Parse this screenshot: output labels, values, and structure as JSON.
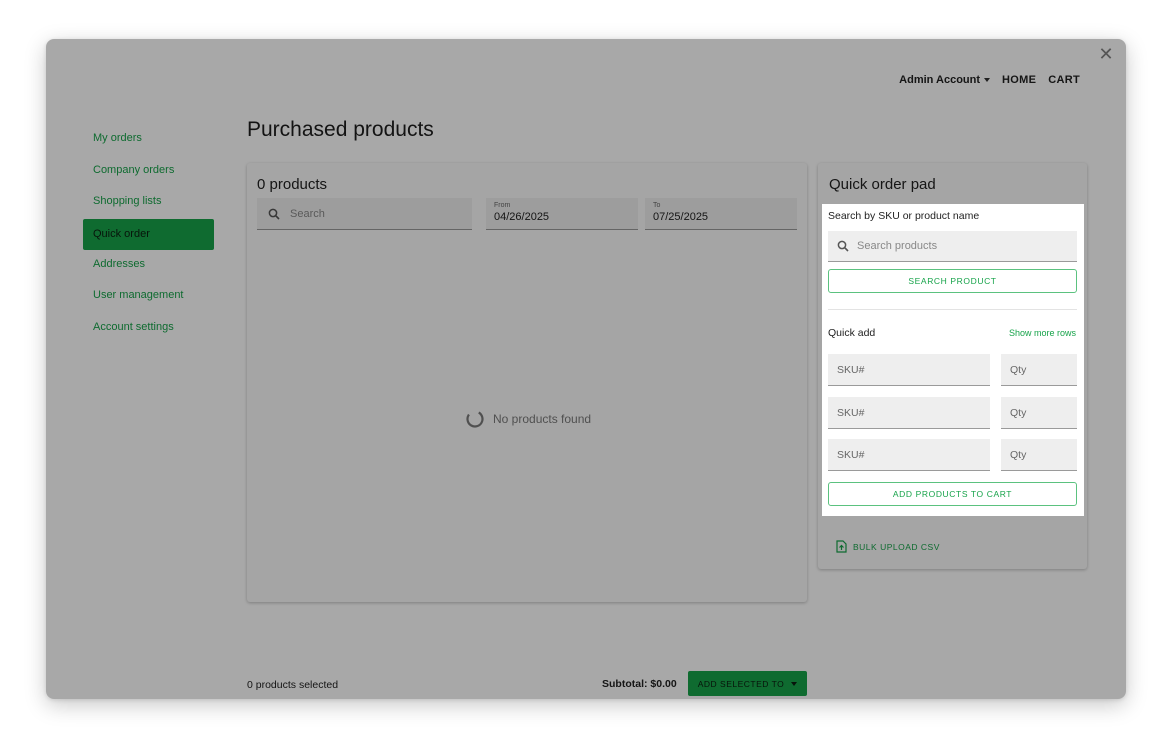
{
  "header": {
    "account_label": "Admin Account",
    "home_label": "HOME",
    "cart_label": "CART"
  },
  "sidebar": {
    "items": [
      {
        "label": "My orders"
      },
      {
        "label": "Company orders"
      },
      {
        "label": "Shopping lists"
      },
      {
        "label": "Quick order"
      },
      {
        "label": "Addresses"
      },
      {
        "label": "User management"
      },
      {
        "label": "Account settings"
      }
    ],
    "active": "Quick order"
  },
  "main": {
    "title": "Purchased products",
    "card_title": "0 products",
    "search_placeholder": "Search",
    "from_label": "From",
    "from_value": "04/26/2025",
    "to_label": "To",
    "to_value": "07/25/2025",
    "empty_text": "No products found"
  },
  "quick_order": {
    "title": "Quick order pad",
    "search_label": "Search by SKU or product name",
    "search_placeholder": "Search products",
    "search_button": "SEARCH PRODUCT",
    "quick_add_label": "Quick add",
    "show_more_label": "Show more rows",
    "rows": [
      {
        "sku": "SKU#",
        "qty": "Qty"
      },
      {
        "sku": "SKU#",
        "qty": "Qty"
      },
      {
        "sku": "SKU#",
        "qty": "Qty"
      }
    ],
    "add_button": "ADD PRODUCTS TO CART",
    "bulk_upload": "BULK UPLOAD CSV"
  },
  "footer": {
    "selected_text": "0 products selected",
    "subtotal_text": "Subtotal: $0.00",
    "add_selected": "ADD SELECTED TO"
  },
  "colors": {
    "accent": "#17a34a"
  }
}
